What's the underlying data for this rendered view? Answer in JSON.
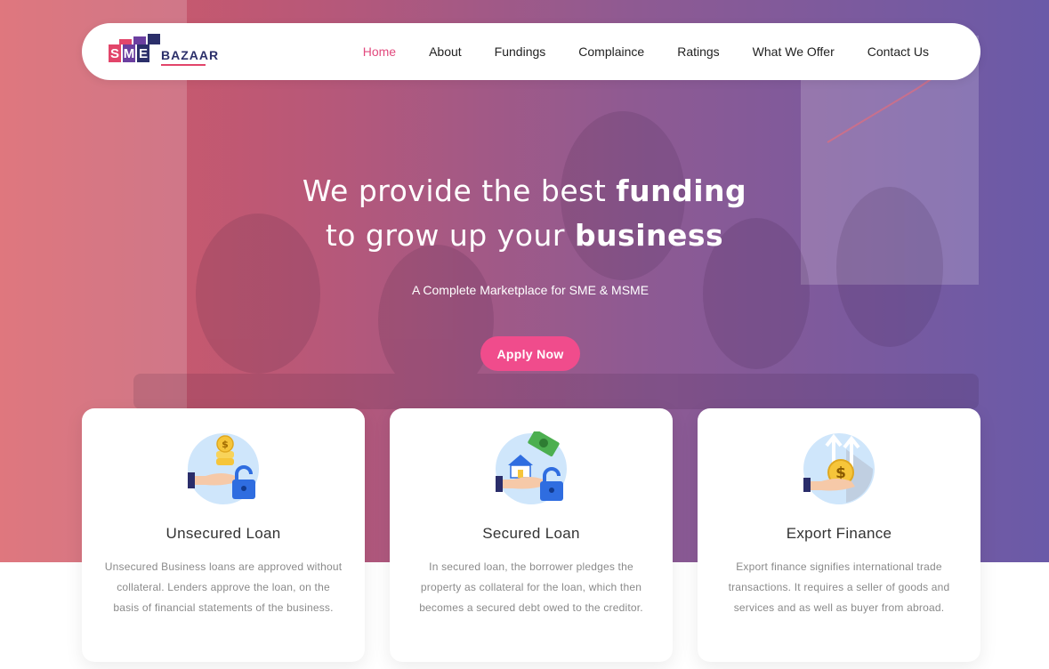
{
  "brand": {
    "logo_initials": [
      "S",
      "M",
      "E"
    ],
    "logo_text": "BAZAAR"
  },
  "nav": {
    "items": [
      {
        "label": "Home",
        "active": true
      },
      {
        "label": "About",
        "active": false
      },
      {
        "label": "Fundings",
        "active": false
      },
      {
        "label": "Complaince",
        "active": false
      },
      {
        "label": "Ratings",
        "active": false
      },
      {
        "label": "What We Offer",
        "active": false
      },
      {
        "label": "Contact Us",
        "active": false
      }
    ]
  },
  "hero": {
    "line1_regular": "We provide the best ",
    "line1_bold": "funding",
    "line2_regular": "to grow up your ",
    "line2_bold": "business",
    "subtitle": "A Complete Marketplace for SME & MSME",
    "cta_label": "Apply Now"
  },
  "cards": [
    {
      "icon": "unsecured-loan-icon",
      "title": "Unsecured Loan",
      "text": "Unsecured Business loans are approved without collateral. Lenders approve the loan, on the basis of financial statements of the business."
    },
    {
      "icon": "secured-loan-icon",
      "title": "Secured Loan",
      "text": "In secured loan, the borrower pledges the property as collateral for the loan, which then becomes a secured debt owed to the creditor."
    },
    {
      "icon": "export-finance-icon",
      "title": "Export Finance",
      "text": "Export finance signifies international trade transactions. It requires a seller of goods and services and as well as buyer from abroad."
    }
  ],
  "colors": {
    "accent": "#f04c8c",
    "nav_active": "#e24a7e",
    "hero_gradient_start": "#d85a62",
    "hero_gradient_end": "#6a5aa8",
    "logo_pink": "#e2456a",
    "logo_purple": "#6b3fa0",
    "logo_navy": "#2b2f6a"
  }
}
